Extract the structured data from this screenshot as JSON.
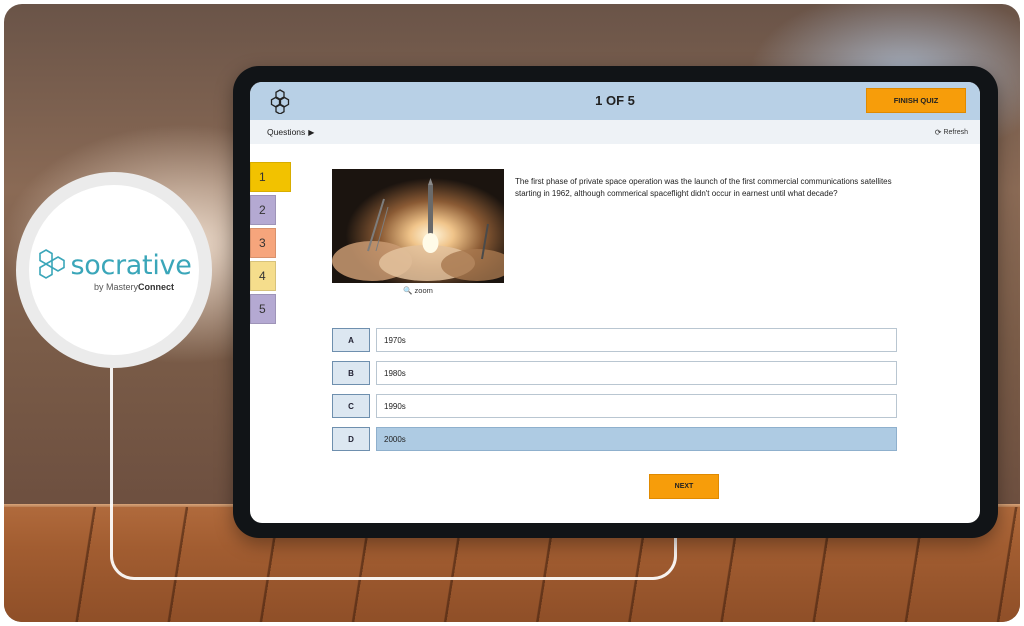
{
  "brand": {
    "name": "socrative",
    "byline_prefix": "by Mastery",
    "byline_suffix": "Connect",
    "color": "#3aa6b9"
  },
  "quiz": {
    "counter": "1 OF 5",
    "finish_label": "FINISH QUIZ",
    "questions_label": "Questions",
    "refresh_label": "Refresh",
    "accent": "#f79d0a"
  },
  "question_nav": [
    {
      "label": "1",
      "color": "#f2c200",
      "current": true
    },
    {
      "label": "2",
      "color": "#b4a9d2",
      "current": false
    },
    {
      "label": "3",
      "color": "#f6a57c",
      "current": false
    },
    {
      "label": "4",
      "color": "#f5dd8c",
      "current": false
    },
    {
      "label": "5",
      "color": "#b4a9d2",
      "current": false
    }
  ],
  "question": {
    "text": "The first phase of private space operation was the launch of the first commercial communications satellites starting in 1962, although commerical spaceflight didn't occur in earnest until what decade?",
    "zoom_label": "zoom",
    "image_subject": "rocket launch"
  },
  "answers": [
    {
      "letter": "A",
      "text": "1970s",
      "selected": false
    },
    {
      "letter": "B",
      "text": "1980s",
      "selected": false
    },
    {
      "letter": "C",
      "text": "1990s",
      "selected": false
    },
    {
      "letter": "D",
      "text": "2000s",
      "selected": true
    }
  ],
  "next_label": "NEXT"
}
